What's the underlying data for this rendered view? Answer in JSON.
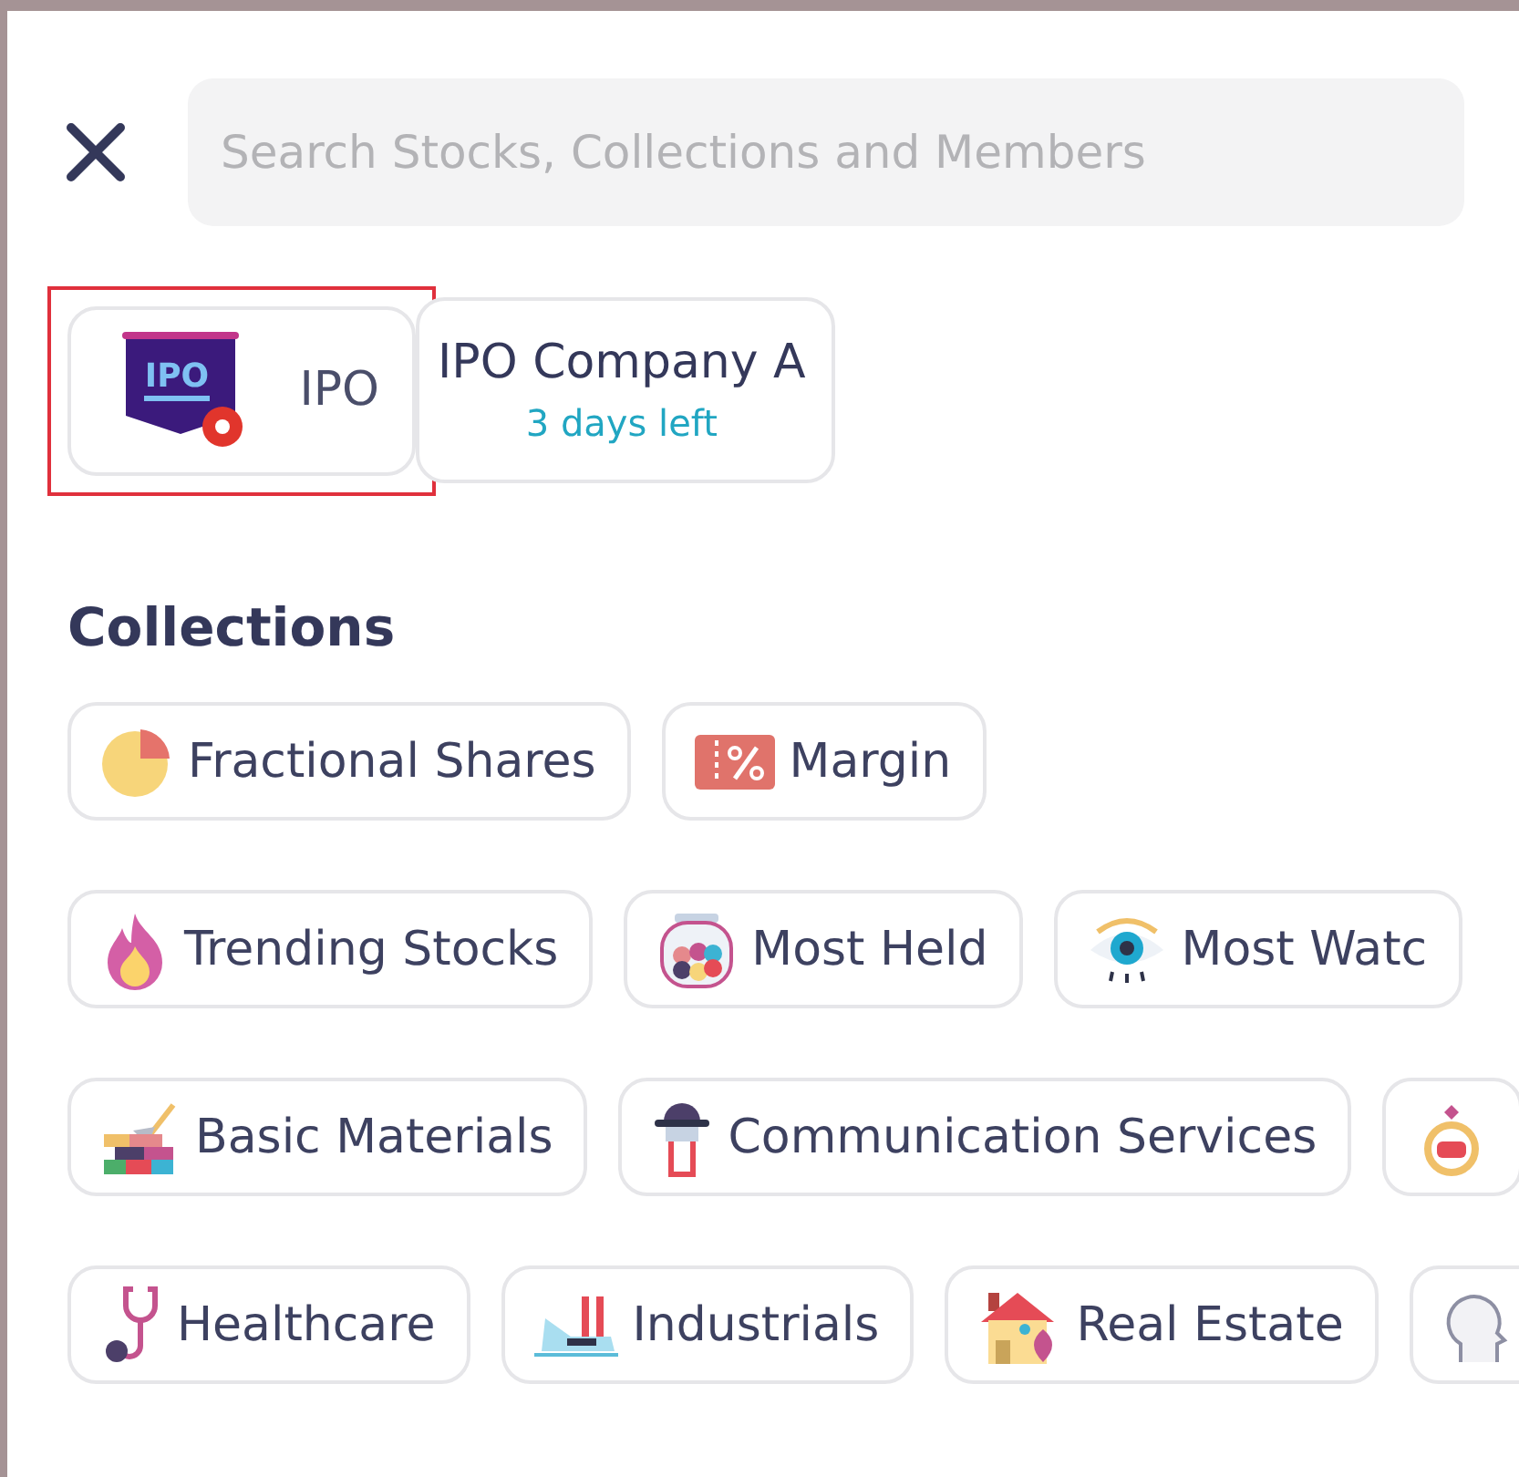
{
  "search": {
    "placeholder": "Search Stocks, Collections and Members"
  },
  "ipo_cards": [
    {
      "kind": "category",
      "badge": "IPO",
      "title": "IPO",
      "highlighted": true
    },
    {
      "kind": "company",
      "title": "IPO Company A",
      "subtitle": "3 days left",
      "highlighted": false
    }
  ],
  "collections": {
    "title": "Collections",
    "rows": [
      [
        {
          "kind": "pie",
          "label": "Fractional Shares"
        },
        {
          "kind": "ticket",
          "label": "Margin"
        }
      ],
      [
        {
          "kind": "flame",
          "label": "Trending Stocks"
        },
        {
          "kind": "jar",
          "label": "Most Held"
        },
        {
          "kind": "eye",
          "label": "Most Watc"
        }
      ],
      [
        {
          "kind": "bricks",
          "label": "Basic Materials"
        },
        {
          "kind": "microphone",
          "label": "Communication Services"
        },
        {
          "kind": "ring"
        }
      ],
      [
        {
          "kind": "stethoscope",
          "label": "Healthcare"
        },
        {
          "kind": "factory",
          "label": "Industrials"
        },
        {
          "kind": "house",
          "label": "Real Estate"
        },
        {
          "kind": "head"
        }
      ]
    ]
  }
}
